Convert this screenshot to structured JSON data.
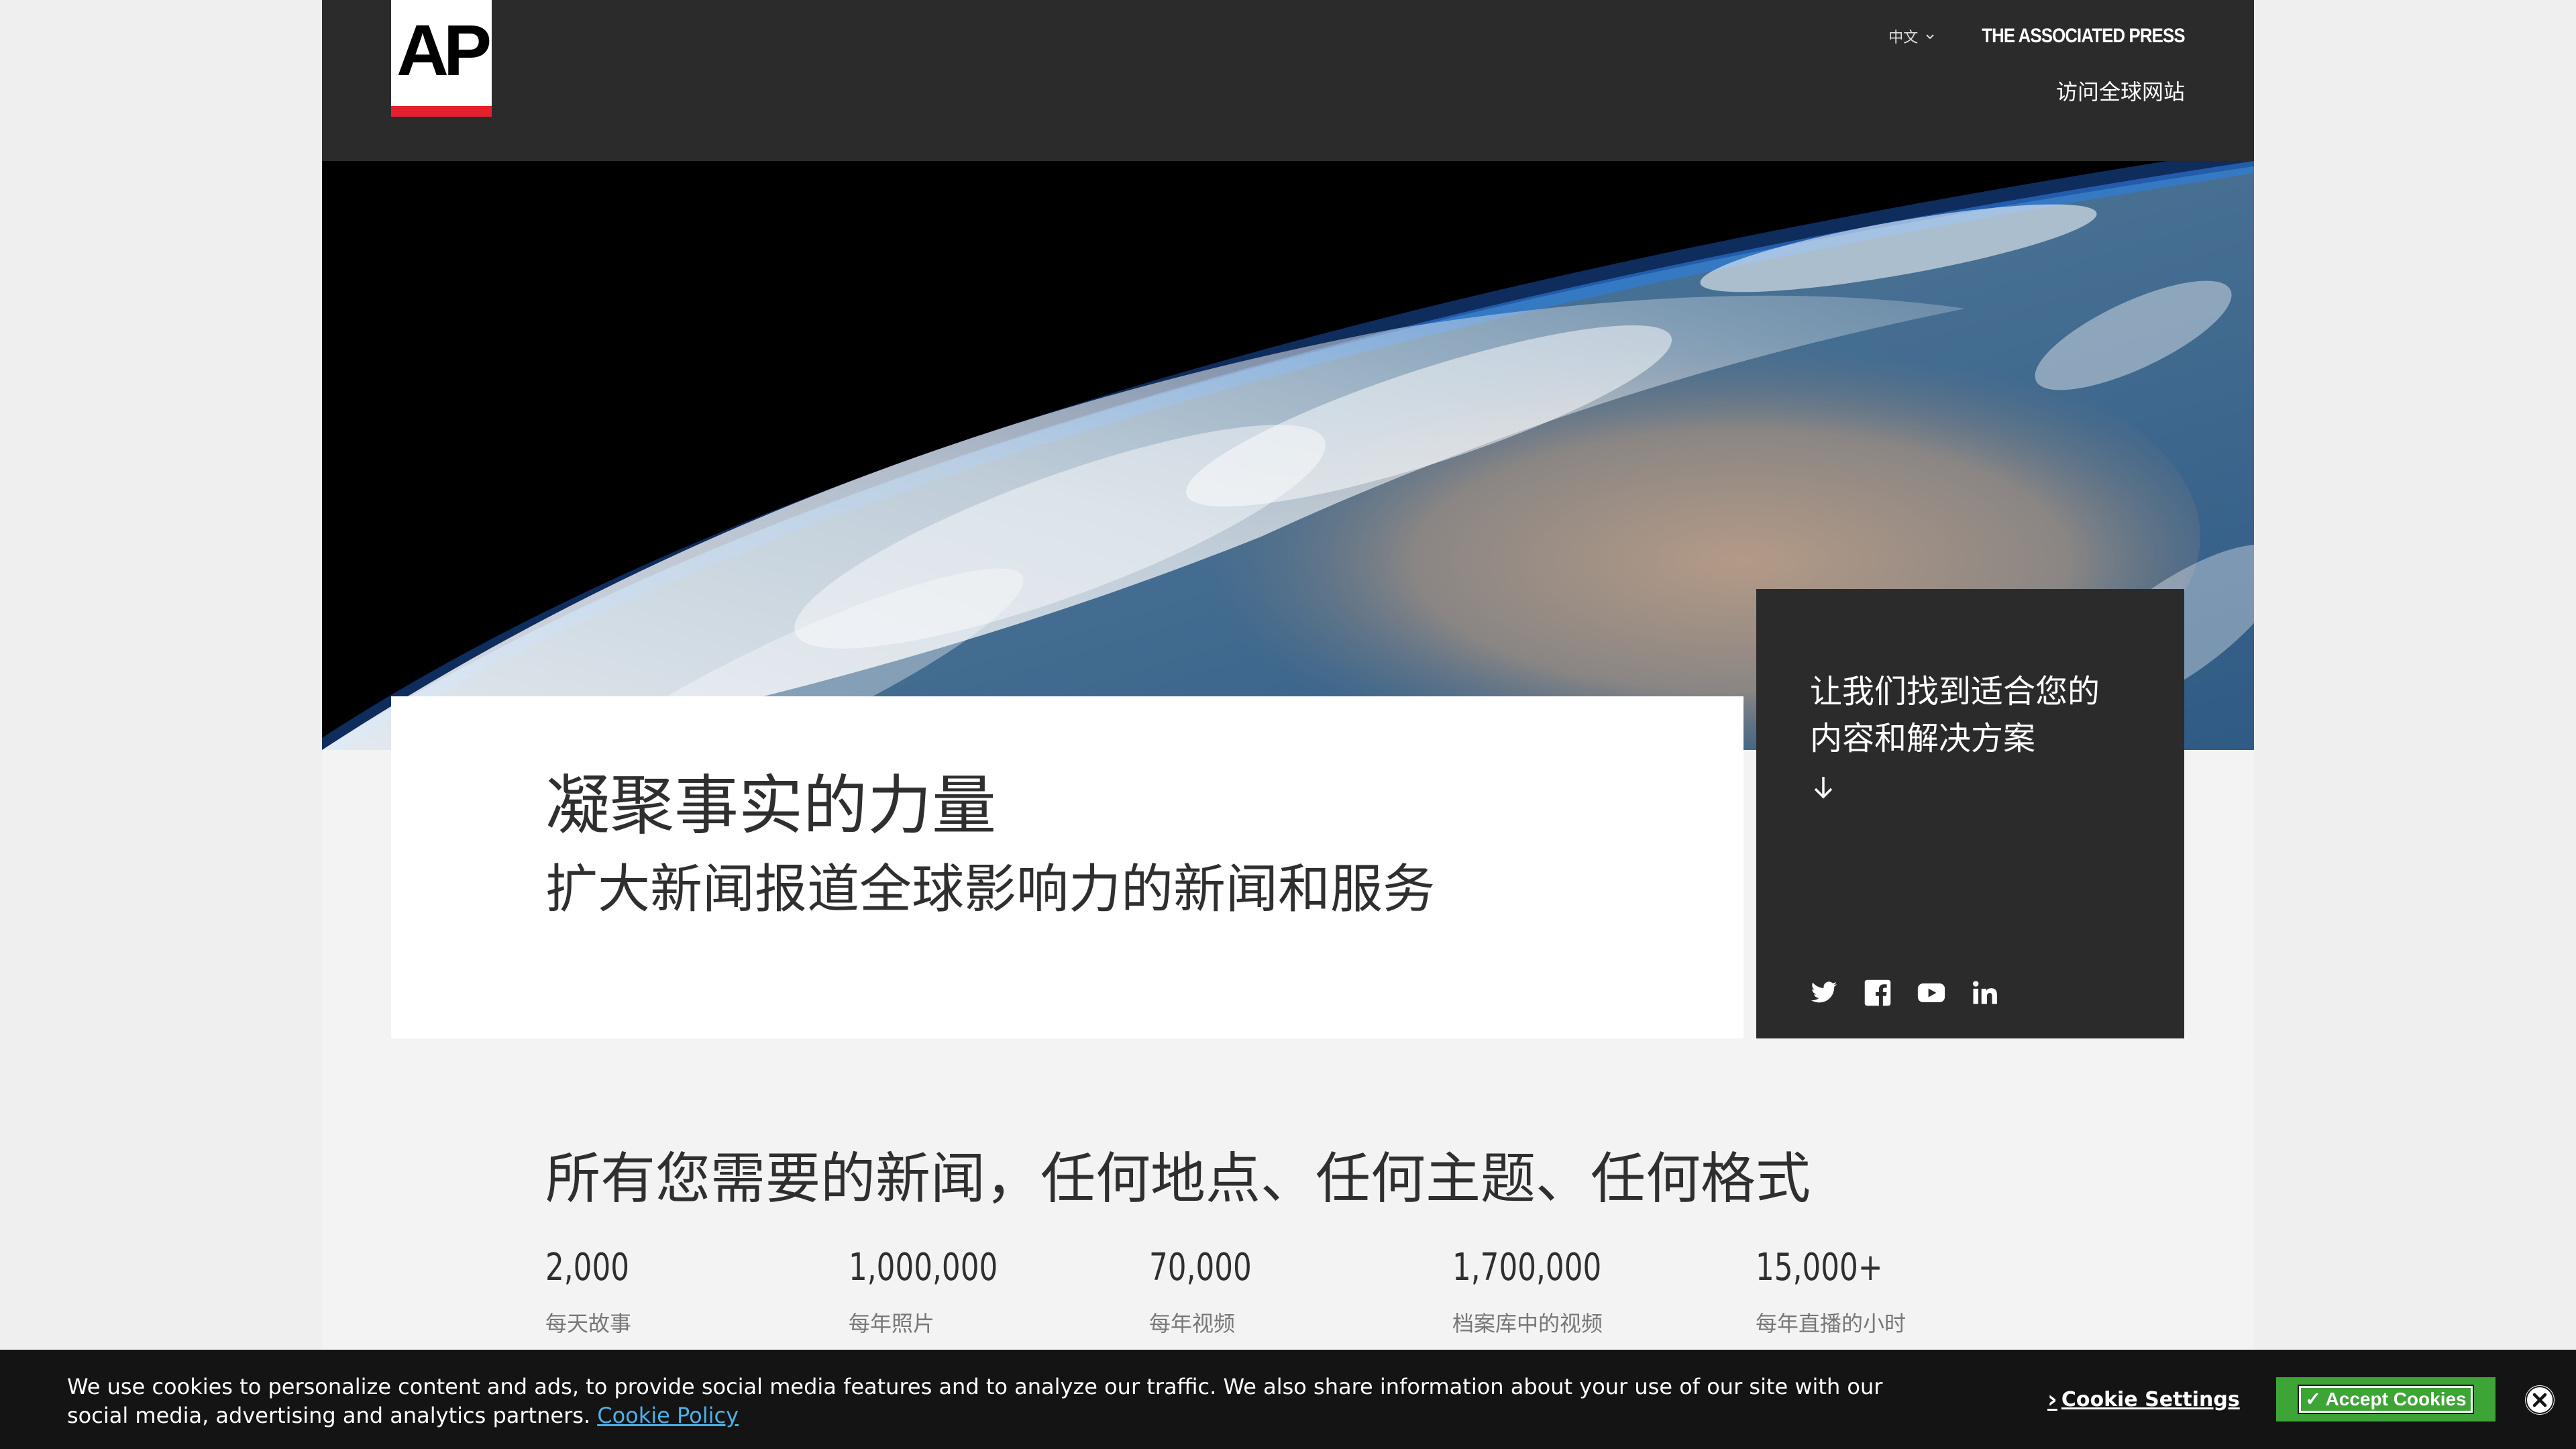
{
  "header": {
    "logo_text": "AP",
    "language": "中文",
    "brand": "THE ASSOCIATED PRESS",
    "global_link": "访问全球网站"
  },
  "hero": {
    "image": "earth-from-space"
  },
  "headline": {
    "main": "凝聚事实的力量",
    "sub": "扩大新闻报道全球影响力的新闻和服务"
  },
  "panel": {
    "line1": "让我们找到适合您的",
    "line2": "内容和解决方案",
    "arrow_icon": "arrow-down-icon",
    "social_icons": [
      "twitter-icon",
      "facebook-icon",
      "youtube-icon",
      "linkedin-icon"
    ]
  },
  "stats": {
    "title": "所有您需要的新闻，任何地点、任何主题、任何格式",
    "items": [
      {
        "value": "2,000",
        "label": "每天故事"
      },
      {
        "value": "1,000,000",
        "label": "每年照片"
      },
      {
        "value": "70,000",
        "label": "每年视频"
      },
      {
        "value": "1,700,000",
        "label": "档案库中的视频"
      },
      {
        "value": "15,000+",
        "label": "每年直播的小时"
      }
    ]
  },
  "cookie": {
    "text": "We use cookies to personalize content and ads, to provide social media features and to analyze our traffic. We also share information about your use of our site with our social media, advertising and analytics partners.",
    "policy_link": "Cookie Policy",
    "settings_label": "Cookie Settings",
    "accept_label": "✓ Accept Cookies"
  },
  "colors": {
    "header_bg": "#2b2b2b",
    "logo_red": "#e5202e",
    "accept_green": "#3da436",
    "link_blue": "#4fb0e6"
  }
}
